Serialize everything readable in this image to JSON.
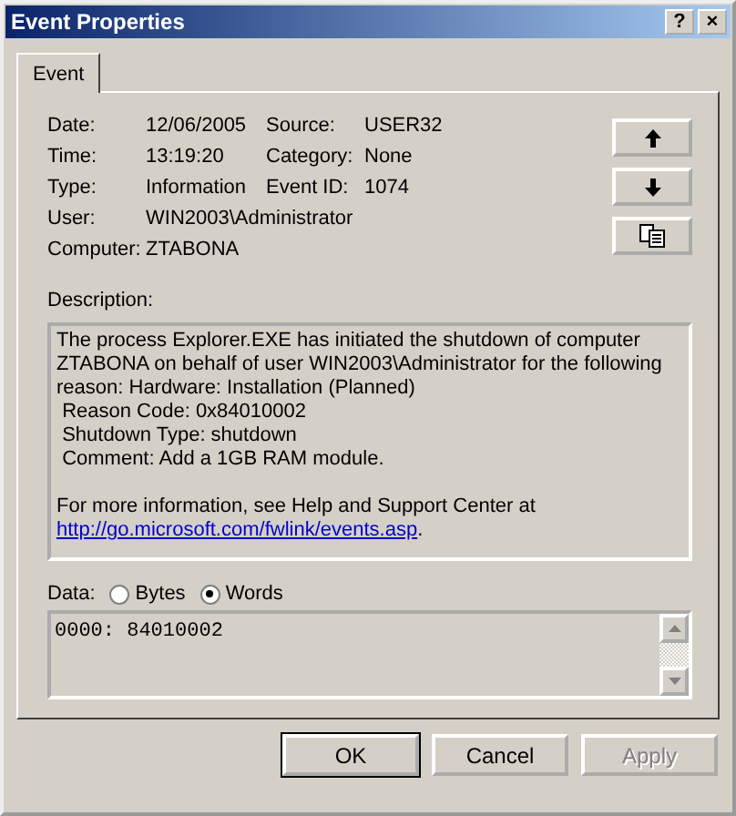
{
  "window": {
    "title": "Event Properties",
    "help": "?",
    "close": "×"
  },
  "tabs": [
    {
      "label": "Event",
      "selected": true
    }
  ],
  "fields": [
    {
      "label": "Date:",
      "value": "12/06/2005",
      "label2": "Source:",
      "value2": "USER32"
    },
    {
      "label": "Time:",
      "value": "13:19:20",
      "label2": "Category:",
      "value2": "None"
    },
    {
      "label": "Type:",
      "value": "Information",
      "label2": "Event ID:",
      "value2": "1074"
    },
    {
      "label": "User:",
      "value": "WIN2003\\Administrator"
    },
    {
      "label": "Computer:",
      "value": "ZTABONA"
    }
  ],
  "side_buttons": [
    {
      "kind": "up"
    },
    {
      "kind": "down"
    },
    {
      "kind": "copy"
    }
  ],
  "description": {
    "label": "Description:",
    "lines": [
      "The process Explorer.EXE has initiated the shutdown of computer ZTABONA on behalf of user WIN2003\\Administrator for the following reason: Hardware: Installation (Planned)",
      " Reason Code: 0x84010002",
      " Shutdown Type: shutdown",
      " Comment: Add a 1GB RAM module."
    ],
    "more_info": "For more information, see Help and Support Center at",
    "link": "http://go.microsoft.com/fwlink/events.asp",
    "link_suffix": "."
  },
  "data": {
    "label": "Data:",
    "options": [
      {
        "label": "Bytes",
        "selected": false
      },
      {
        "label": "Words",
        "selected": true
      }
    ],
    "content": "0000: 84010002"
  },
  "buttons": [
    {
      "label": "OK",
      "disabled": false,
      "default": true
    },
    {
      "label": "Cancel",
      "disabled": false,
      "default": false
    },
    {
      "label": "Apply",
      "disabled": true,
      "default": false
    }
  ]
}
